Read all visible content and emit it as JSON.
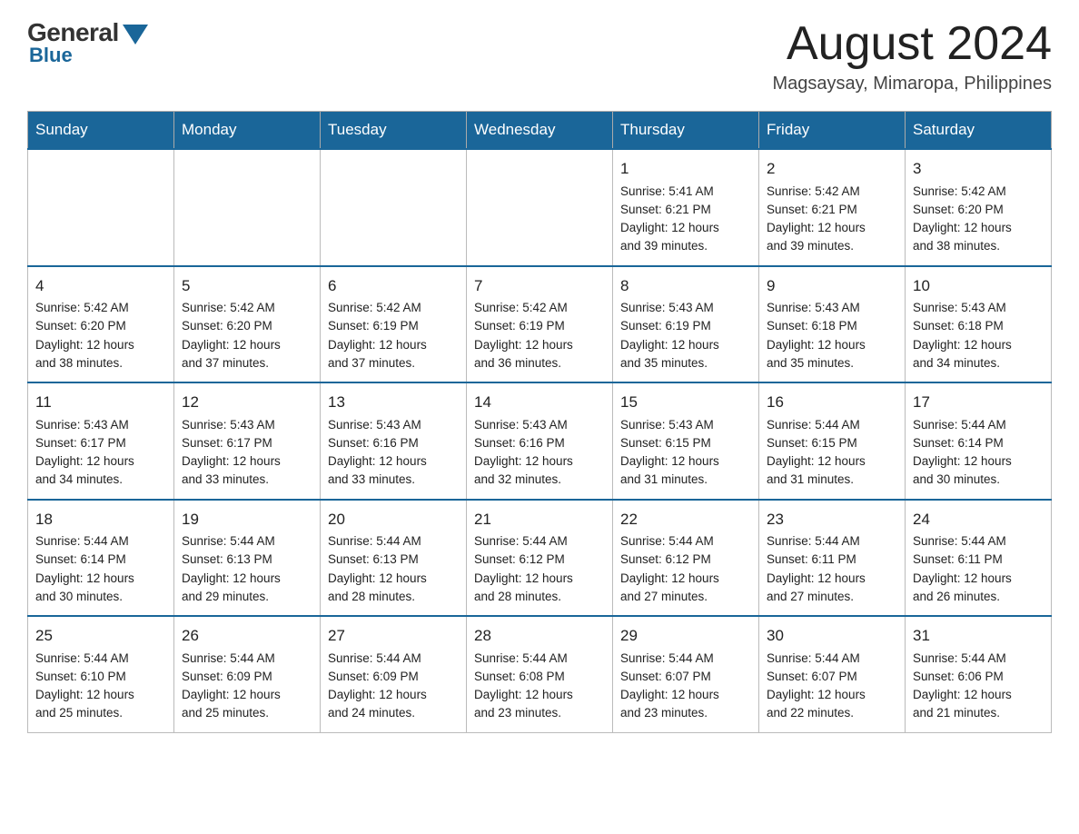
{
  "header": {
    "logo": {
      "general": "General",
      "blue": "Blue"
    },
    "title": "August 2024",
    "subtitle": "Magsaysay, Mimaropa, Philippines"
  },
  "days_of_week": [
    "Sunday",
    "Monday",
    "Tuesday",
    "Wednesday",
    "Thursday",
    "Friday",
    "Saturday"
  ],
  "weeks": [
    {
      "days": [
        {
          "num": "",
          "info": ""
        },
        {
          "num": "",
          "info": ""
        },
        {
          "num": "",
          "info": ""
        },
        {
          "num": "",
          "info": ""
        },
        {
          "num": "1",
          "info": "Sunrise: 5:41 AM\nSunset: 6:21 PM\nDaylight: 12 hours\nand 39 minutes."
        },
        {
          "num": "2",
          "info": "Sunrise: 5:42 AM\nSunset: 6:21 PM\nDaylight: 12 hours\nand 39 minutes."
        },
        {
          "num": "3",
          "info": "Sunrise: 5:42 AM\nSunset: 6:20 PM\nDaylight: 12 hours\nand 38 minutes."
        }
      ]
    },
    {
      "days": [
        {
          "num": "4",
          "info": "Sunrise: 5:42 AM\nSunset: 6:20 PM\nDaylight: 12 hours\nand 38 minutes."
        },
        {
          "num": "5",
          "info": "Sunrise: 5:42 AM\nSunset: 6:20 PM\nDaylight: 12 hours\nand 37 minutes."
        },
        {
          "num": "6",
          "info": "Sunrise: 5:42 AM\nSunset: 6:19 PM\nDaylight: 12 hours\nand 37 minutes."
        },
        {
          "num": "7",
          "info": "Sunrise: 5:42 AM\nSunset: 6:19 PM\nDaylight: 12 hours\nand 36 minutes."
        },
        {
          "num": "8",
          "info": "Sunrise: 5:43 AM\nSunset: 6:19 PM\nDaylight: 12 hours\nand 35 minutes."
        },
        {
          "num": "9",
          "info": "Sunrise: 5:43 AM\nSunset: 6:18 PM\nDaylight: 12 hours\nand 35 minutes."
        },
        {
          "num": "10",
          "info": "Sunrise: 5:43 AM\nSunset: 6:18 PM\nDaylight: 12 hours\nand 34 minutes."
        }
      ]
    },
    {
      "days": [
        {
          "num": "11",
          "info": "Sunrise: 5:43 AM\nSunset: 6:17 PM\nDaylight: 12 hours\nand 34 minutes."
        },
        {
          "num": "12",
          "info": "Sunrise: 5:43 AM\nSunset: 6:17 PM\nDaylight: 12 hours\nand 33 minutes."
        },
        {
          "num": "13",
          "info": "Sunrise: 5:43 AM\nSunset: 6:16 PM\nDaylight: 12 hours\nand 33 minutes."
        },
        {
          "num": "14",
          "info": "Sunrise: 5:43 AM\nSunset: 6:16 PM\nDaylight: 12 hours\nand 32 minutes."
        },
        {
          "num": "15",
          "info": "Sunrise: 5:43 AM\nSunset: 6:15 PM\nDaylight: 12 hours\nand 31 minutes."
        },
        {
          "num": "16",
          "info": "Sunrise: 5:44 AM\nSunset: 6:15 PM\nDaylight: 12 hours\nand 31 minutes."
        },
        {
          "num": "17",
          "info": "Sunrise: 5:44 AM\nSunset: 6:14 PM\nDaylight: 12 hours\nand 30 minutes."
        }
      ]
    },
    {
      "days": [
        {
          "num": "18",
          "info": "Sunrise: 5:44 AM\nSunset: 6:14 PM\nDaylight: 12 hours\nand 30 minutes."
        },
        {
          "num": "19",
          "info": "Sunrise: 5:44 AM\nSunset: 6:13 PM\nDaylight: 12 hours\nand 29 minutes."
        },
        {
          "num": "20",
          "info": "Sunrise: 5:44 AM\nSunset: 6:13 PM\nDaylight: 12 hours\nand 28 minutes."
        },
        {
          "num": "21",
          "info": "Sunrise: 5:44 AM\nSunset: 6:12 PM\nDaylight: 12 hours\nand 28 minutes."
        },
        {
          "num": "22",
          "info": "Sunrise: 5:44 AM\nSunset: 6:12 PM\nDaylight: 12 hours\nand 27 minutes."
        },
        {
          "num": "23",
          "info": "Sunrise: 5:44 AM\nSunset: 6:11 PM\nDaylight: 12 hours\nand 27 minutes."
        },
        {
          "num": "24",
          "info": "Sunrise: 5:44 AM\nSunset: 6:11 PM\nDaylight: 12 hours\nand 26 minutes."
        }
      ]
    },
    {
      "days": [
        {
          "num": "25",
          "info": "Sunrise: 5:44 AM\nSunset: 6:10 PM\nDaylight: 12 hours\nand 25 minutes."
        },
        {
          "num": "26",
          "info": "Sunrise: 5:44 AM\nSunset: 6:09 PM\nDaylight: 12 hours\nand 25 minutes."
        },
        {
          "num": "27",
          "info": "Sunrise: 5:44 AM\nSunset: 6:09 PM\nDaylight: 12 hours\nand 24 minutes."
        },
        {
          "num": "28",
          "info": "Sunrise: 5:44 AM\nSunset: 6:08 PM\nDaylight: 12 hours\nand 23 minutes."
        },
        {
          "num": "29",
          "info": "Sunrise: 5:44 AM\nSunset: 6:07 PM\nDaylight: 12 hours\nand 23 minutes."
        },
        {
          "num": "30",
          "info": "Sunrise: 5:44 AM\nSunset: 6:07 PM\nDaylight: 12 hours\nand 22 minutes."
        },
        {
          "num": "31",
          "info": "Sunrise: 5:44 AM\nSunset: 6:06 PM\nDaylight: 12 hours\nand 21 minutes."
        }
      ]
    }
  ]
}
